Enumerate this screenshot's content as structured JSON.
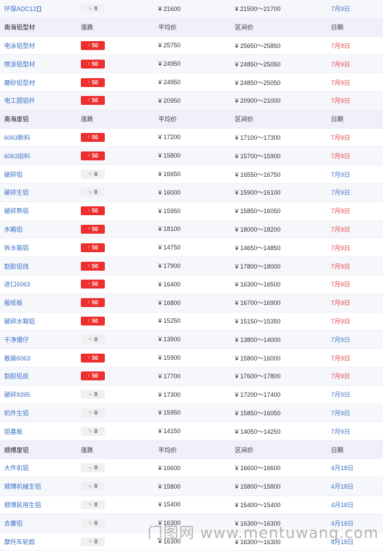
{
  "col_labels": {
    "change": "涨跌",
    "avg": "平均价",
    "range": "区间价",
    "date": "日期"
  },
  "first_row": {
    "name": "环保ADC12",
    "change": "0",
    "dir": "flat",
    "avg": "¥ 21600",
    "range": "¥ 21500～21700",
    "date": "7月9日"
  },
  "groups": [
    {
      "title": "南海铝型材",
      "rows": [
        {
          "name": "电泳铝型材",
          "change": "50",
          "dir": "up",
          "avg": "¥ 25750",
          "range": "¥ 25650～25850",
          "date": "7月9日"
        },
        {
          "name": "喷涂铝型材",
          "change": "50",
          "dir": "up",
          "avg": "¥ 24950",
          "range": "¥ 24850～25050",
          "date": "7月9日"
        },
        {
          "name": "磨砂铝型材",
          "change": "50",
          "dir": "up",
          "avg": "¥ 24950",
          "range": "¥ 24850～25050",
          "date": "7月9日"
        },
        {
          "name": "电工圆铝杆",
          "change": "50",
          "dir": "up",
          "avg": "¥ 20950",
          "range": "¥ 20900～21000",
          "date": "7月9日"
        }
      ]
    },
    {
      "title": "南海废铝",
      "rows": [
        {
          "name": "6063新料",
          "change": "50",
          "dir": "up",
          "avg": "¥ 17200",
          "range": "¥ 17100～17300",
          "date": "7月9日"
        },
        {
          "name": "6063旧料",
          "change": "50",
          "dir": "up",
          "avg": "¥ 15800",
          "range": "¥ 15700～15900",
          "date": "7月9日"
        },
        {
          "name": "破碎铝",
          "change": "0",
          "dir": "flat",
          "avg": "¥ 16650",
          "range": "¥ 16550～16750",
          "date": "7月9日"
        },
        {
          "name": "破碎生铝",
          "change": "0",
          "dir": "flat",
          "avg": "¥ 16000",
          "range": "¥ 15900～16100",
          "date": "7月9日"
        },
        {
          "name": "破碎熟铝",
          "change": "50",
          "dir": "up",
          "avg": "¥ 15950",
          "range": "¥ 15850～16050",
          "date": "7月9日"
        },
        {
          "name": "水箱铝",
          "change": "50",
          "dir": "up",
          "avg": "¥ 18100",
          "range": "¥ 18000～18200",
          "date": "7月9日"
        },
        {
          "name": "拆水箱铝",
          "change": "50",
          "dir": "up",
          "avg": "¥ 14750",
          "range": "¥ 14650～14850",
          "date": "7月9日"
        },
        {
          "name": "割胶铝线",
          "change": "50",
          "dir": "up",
          "avg": "¥ 17900",
          "range": "¥ 17800～18000",
          "date": "7月9日"
        },
        {
          "name": "进口6063",
          "change": "50",
          "dir": "up",
          "avg": "¥ 16400",
          "range": "¥ 16300～16500",
          "date": "7月9日"
        },
        {
          "name": "报纸板",
          "change": "50",
          "dir": "up",
          "avg": "¥ 16800",
          "range": "¥ 16700～16900",
          "date": "7月9日"
        },
        {
          "name": "破碎水箱铝",
          "change": "50",
          "dir": "up",
          "avg": "¥ 15250",
          "range": "¥ 15150～15350",
          "date": "7月9日"
        },
        {
          "name": "干净镙仔",
          "change": "0",
          "dir": "flat",
          "avg": "¥ 13900",
          "range": "¥ 13800～14000",
          "date": "7月9日"
        },
        {
          "name": "散装6063",
          "change": "50",
          "dir": "up",
          "avg": "¥ 15900",
          "range": "¥ 15800～16000",
          "date": "7月9日"
        },
        {
          "name": "割胶铝皮",
          "change": "50",
          "dir": "up",
          "avg": "¥ 17700",
          "range": "¥ 17600～17800",
          "date": "7月9日"
        },
        {
          "name": "破碎9395",
          "change": "0",
          "dir": "flat",
          "avg": "¥ 17300",
          "range": "¥ 17200～17400",
          "date": "7月9日"
        },
        {
          "name": "机件生铝",
          "change": "0",
          "dir": "flat",
          "avg": "¥ 15950",
          "range": "¥ 15850～16050",
          "date": "7月9日"
        },
        {
          "name": "铝基板",
          "change": "0",
          "dir": "flat",
          "avg": "¥ 14150",
          "range": "¥ 14050～14250",
          "date": "7月9日"
        }
      ]
    },
    {
      "title": "顺搏废铝",
      "rows": [
        {
          "name": "大件机铝",
          "change": "0",
          "dir": "flat",
          "avg": "¥ 16600",
          "range": "¥ 16600～16600",
          "date": "4月18日"
        },
        {
          "name": "顺博机械生铝",
          "change": "0",
          "dir": "flat",
          "avg": "¥ 15800",
          "range": "¥ 15800～15800",
          "date": "4月18日"
        },
        {
          "name": "顺博民用生铝",
          "change": "0",
          "dir": "flat",
          "avg": "¥ 15400",
          "range": "¥ 15400～15400",
          "date": "4月18日"
        },
        {
          "name": "合塞铝",
          "change": "0",
          "dir": "flat",
          "avg": "¥ 16300",
          "range": "¥ 16300～16300",
          "date": "4月18日"
        },
        {
          "name": "摩托车轮毂",
          "change": "0",
          "dir": "flat",
          "avg": "¥ 16300",
          "range": "¥ 16300～16300",
          "date": "4月18日"
        }
      ]
    }
  ],
  "icons": {
    "up": "arrow-up-icon",
    "flat": "flat-trend-icon"
  },
  "colors": {
    "up_badge": "#ee2f2f",
    "up_date": "#e23b3b",
    "link": "#3a6fc4",
    "header_bg": "#f1effa"
  },
  "watermark": "门图网 www.mentuwang.com"
}
